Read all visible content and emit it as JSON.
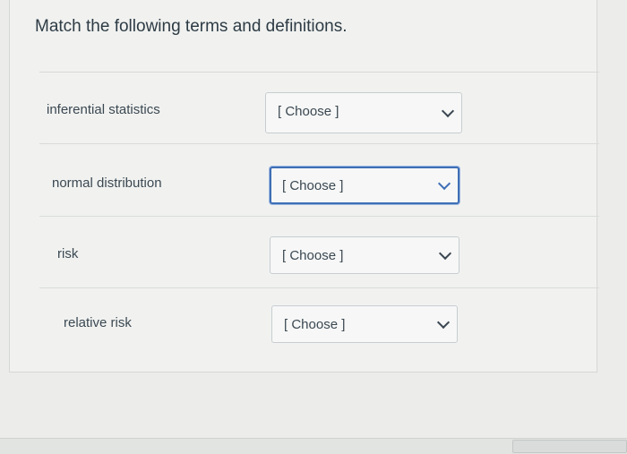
{
  "question": {
    "text": "Match the following terms and definitions."
  },
  "rows": [
    {
      "term": "inferential statistics",
      "selected": "[ Choose ]"
    },
    {
      "term": "normal distribution",
      "selected": "[ Choose ]"
    },
    {
      "term": "risk",
      "selected": "[ Choose ]"
    },
    {
      "term": "relative risk",
      "selected": "[ Choose ]"
    }
  ],
  "icons": {
    "dropdown": "chevron-down-icon"
  },
  "colors": {
    "focus_border": "#3f6fb6",
    "text": "#2d3b45"
  }
}
